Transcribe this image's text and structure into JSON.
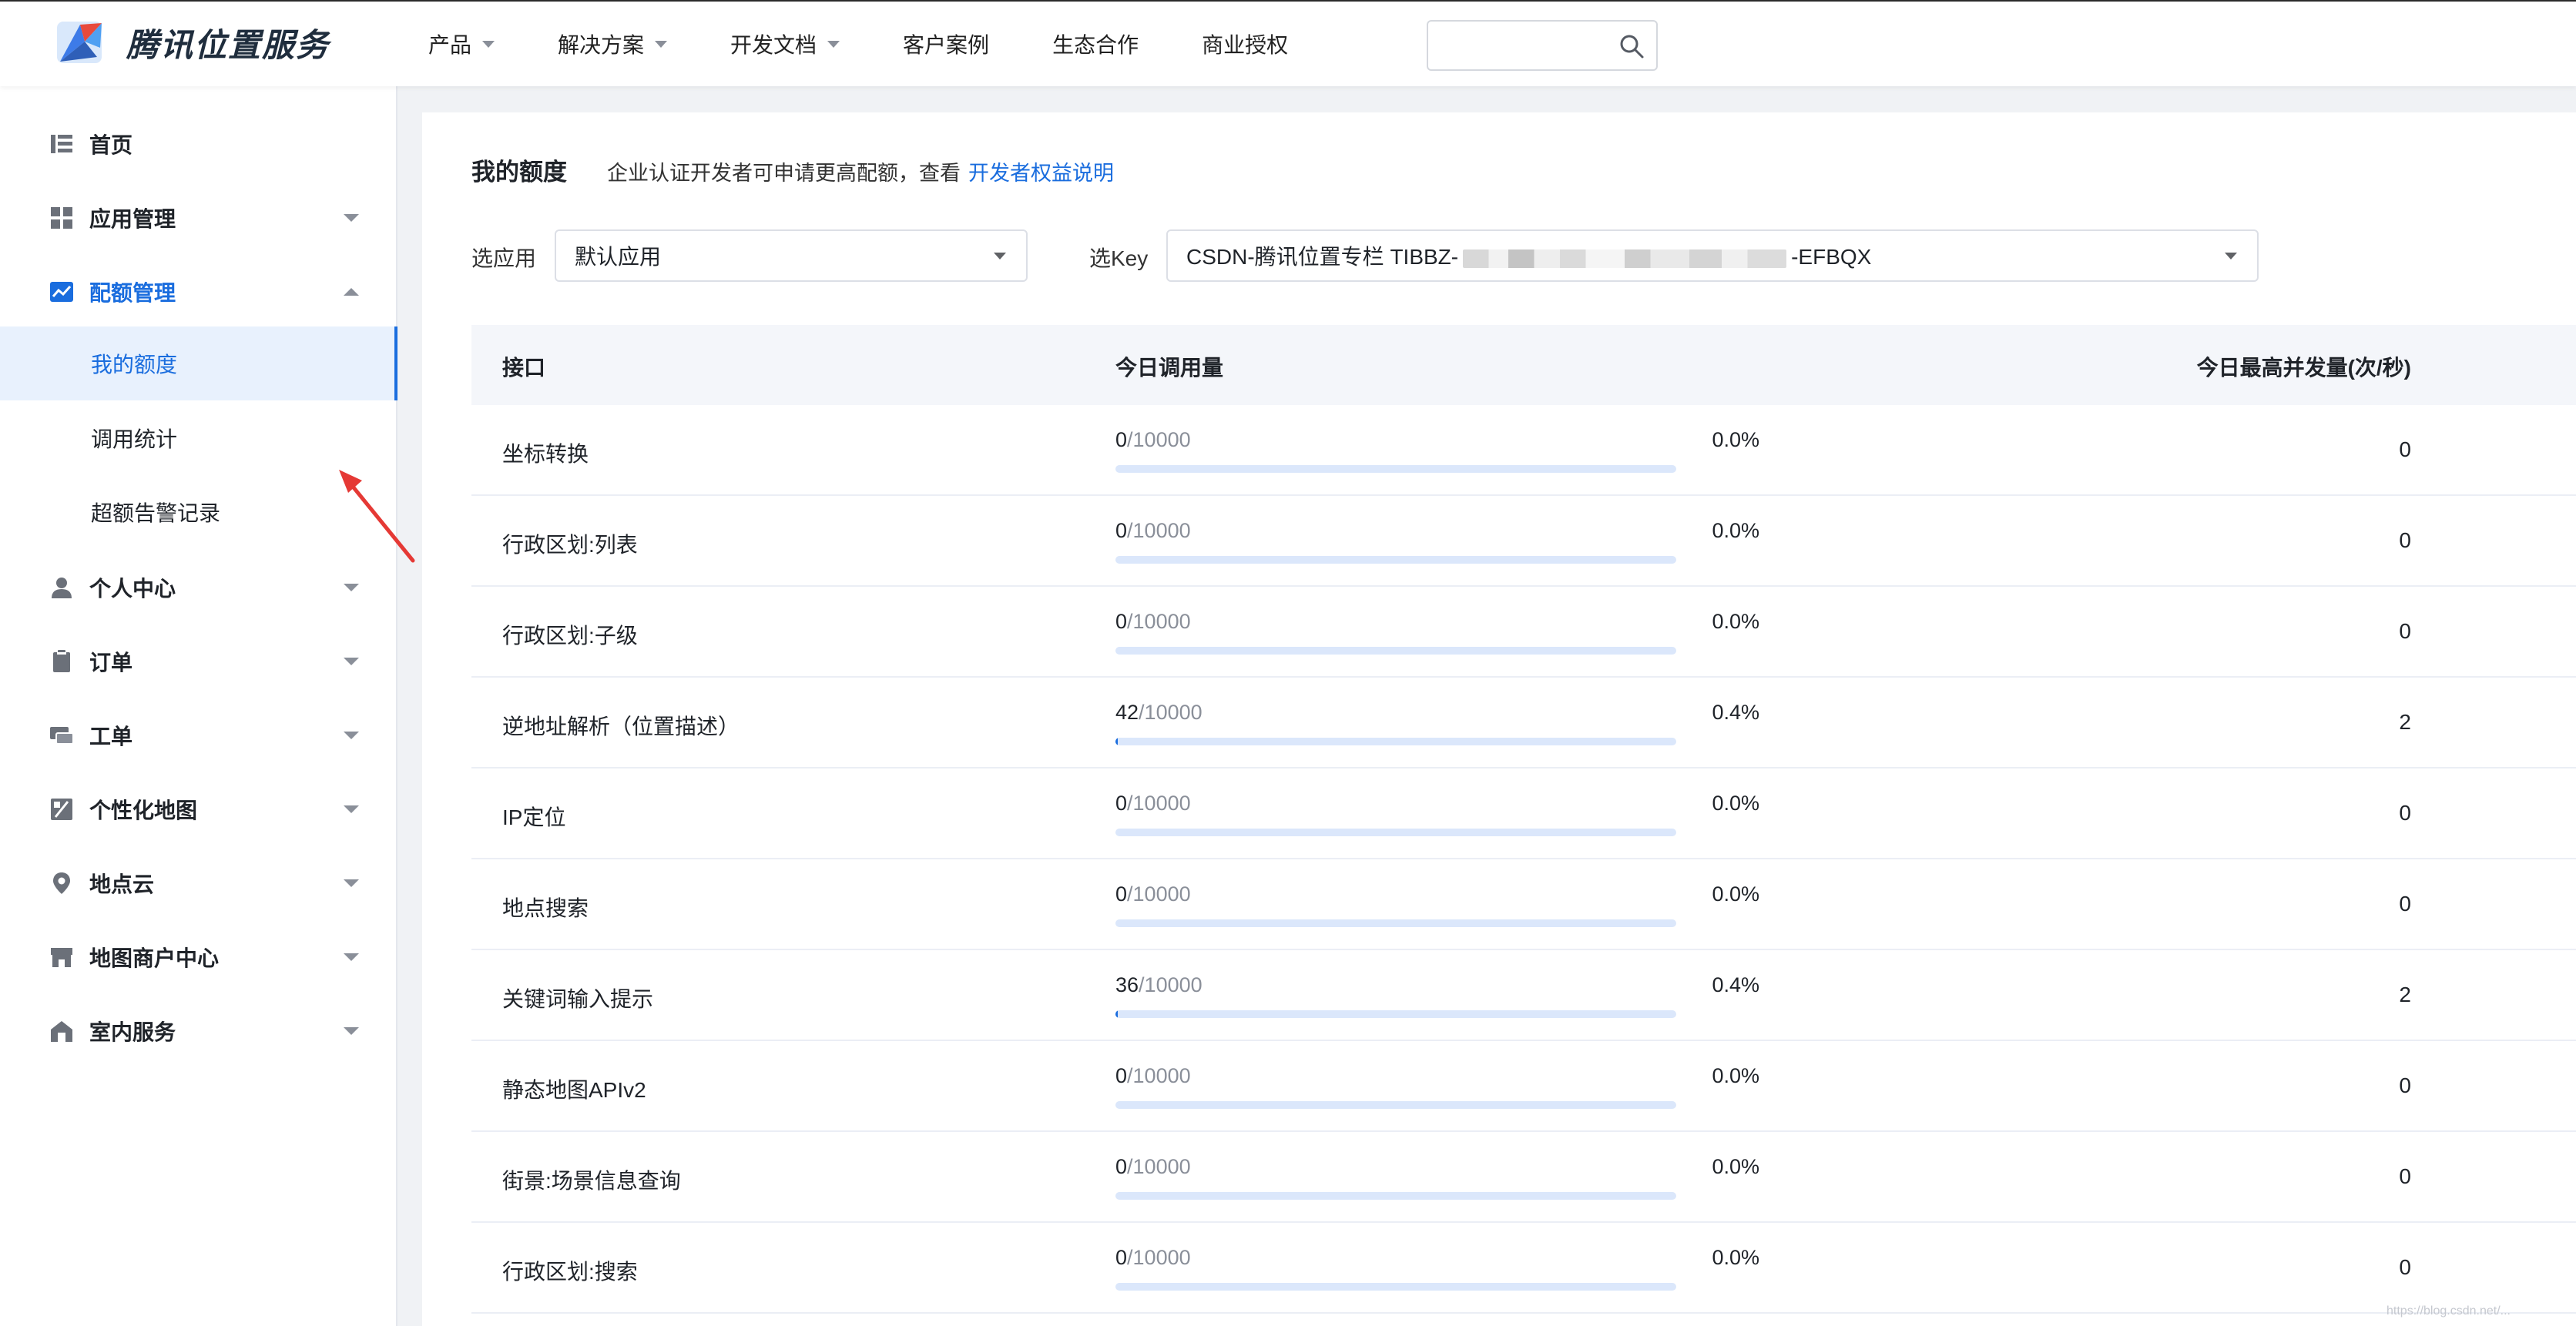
{
  "header": {
    "brand": "腾讯位置服务",
    "nav": [
      {
        "label": "产品",
        "dropdown": true
      },
      {
        "label": "解决方案",
        "dropdown": true
      },
      {
        "label": "开发文档",
        "dropdown": true
      },
      {
        "label": "客户案例",
        "dropdown": false
      },
      {
        "label": "生态合作",
        "dropdown": false
      },
      {
        "label": "商业授权",
        "dropdown": false
      }
    ],
    "search_icon": "search-icon"
  },
  "sidebar": {
    "items": [
      {
        "label": "首页",
        "icon": "list-icon"
      },
      {
        "label": "应用管理",
        "icon": "grid-icon"
      },
      {
        "label": "配额管理",
        "icon": "chart-icon"
      },
      {
        "label": "我的额度"
      },
      {
        "label": "调用统计"
      },
      {
        "label": "超额告警记录"
      },
      {
        "label": "个人中心",
        "icon": "user-icon"
      },
      {
        "label": "订单",
        "icon": "clipboard-icon"
      },
      {
        "label": "工单",
        "icon": "ticket-icon"
      },
      {
        "label": "个性化地图",
        "icon": "map-style-icon"
      },
      {
        "label": "地点云",
        "icon": "location-pin-icon"
      },
      {
        "label": "地图商户中心",
        "icon": "store-icon"
      },
      {
        "label": "室内服务",
        "icon": "building-icon"
      }
    ]
  },
  "main": {
    "title": "我的额度",
    "description": "企业认证开发者可申请更高配额，查看",
    "link": "开发者权益说明",
    "app_label": "选应用",
    "app_value": "默认应用",
    "key_label": "选Key",
    "key_prefix": "CSDN-腾讯位置专栏 TIBBZ-",
    "key_suffix": "-EFBQX",
    "table": {
      "headers": [
        "接口",
        "今日调用量",
        "今日最高并发量(次/秒)"
      ],
      "rows": [
        {
          "name": "坐标转换",
          "used": "0",
          "total": "/10000",
          "pct_text": "0.0%",
          "pct": 0.0,
          "peak": "0"
        },
        {
          "name": "行政区划:列表",
          "used": "0",
          "total": "/10000",
          "pct_text": "0.0%",
          "pct": 0.0,
          "peak": "0"
        },
        {
          "name": "行政区划:子级",
          "used": "0",
          "total": "/10000",
          "pct_text": "0.0%",
          "pct": 0.0,
          "peak": "0"
        },
        {
          "name": "逆地址解析（位置描述）",
          "used": "42",
          "total": "/10000",
          "pct_text": "0.4%",
          "pct": 0.42,
          "peak": "2"
        },
        {
          "name": "IP定位",
          "used": "0",
          "total": "/10000",
          "pct_text": "0.0%",
          "pct": 0.0,
          "peak": "0"
        },
        {
          "name": "地点搜索",
          "used": "0",
          "total": "/10000",
          "pct_text": "0.0%",
          "pct": 0.0,
          "peak": "0"
        },
        {
          "name": "关键词输入提示",
          "used": "36",
          "total": "/10000",
          "pct_text": "0.4%",
          "pct": 0.36,
          "peak": "2"
        },
        {
          "name": "静态地图APIv2",
          "used": "0",
          "total": "/10000",
          "pct_text": "0.0%",
          "pct": 0.0,
          "peak": "0"
        },
        {
          "name": "街景:场景信息查询",
          "used": "0",
          "total": "/10000",
          "pct_text": "0.0%",
          "pct": 0.0,
          "peak": "0"
        },
        {
          "name": "行政区划:搜索",
          "used": "0",
          "total": "/10000",
          "pct_text": "0.0%",
          "pct": 0.0,
          "peak": "0"
        }
      ]
    }
  },
  "colors": {
    "accent": "#1a6dde",
    "bar_track": "#dbe7fb",
    "annotation_arrow": "#e53935"
  },
  "watermark": "https://blog.csdn.net/..."
}
